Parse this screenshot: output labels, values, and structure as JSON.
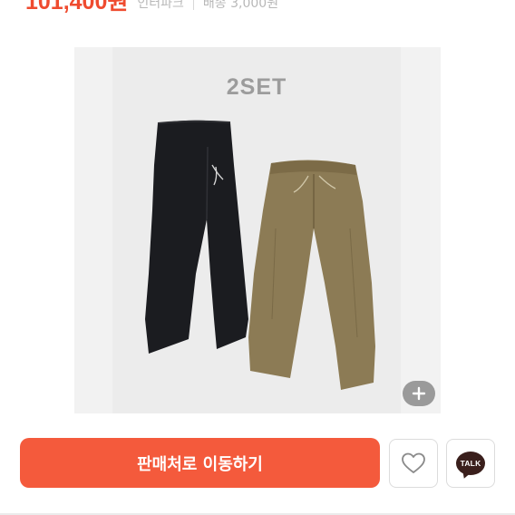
{
  "product": {
    "price": "101,400원",
    "mall_name": "인터파크",
    "shipping": "배송 3,000원"
  },
  "image": {
    "set_label": "2SET",
    "zoom_icon": "plus-icon"
  },
  "actions": {
    "cta_label": "판매처로 이동하기",
    "like_icon": "heart-icon",
    "talk_label": "TALK",
    "talk_icon": "kakao-talk-icon"
  },
  "colors": {
    "price": "#ef4b2f",
    "cta_background": "#f45a3c",
    "talk_bubble": "#3a1f1c",
    "black_pants": "#1b1c20",
    "khaki_pants": "#8c7b55"
  }
}
